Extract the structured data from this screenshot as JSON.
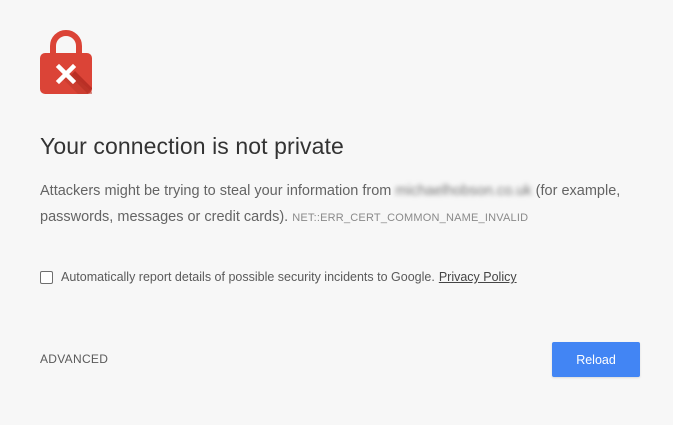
{
  "icon": {
    "name": "lock-error-icon",
    "color": "#db4437",
    "shadow_color": "#b52e24",
    "mark_color": "#ffffff"
  },
  "title": "Your connection is not private",
  "explanation": {
    "text_before": "Attackers might be trying to steal your information from ",
    "blurred_domain": "michaelhobson.co.uk",
    "text_after": " (for example, passwords, messages or credit cards).",
    "error_code": "NET::ERR_CERT_COMMON_NAME_INVALID"
  },
  "report": {
    "checked": false,
    "label": "Automatically report details of possible security incidents to Google.",
    "privacy_link": "Privacy Policy"
  },
  "buttons": {
    "advanced": "ADVANCED",
    "reload": "Reload"
  },
  "colors": {
    "background": "#f7f7f7",
    "primary_button": "#4285f4",
    "title_text": "#333333",
    "body_text": "#646464"
  }
}
